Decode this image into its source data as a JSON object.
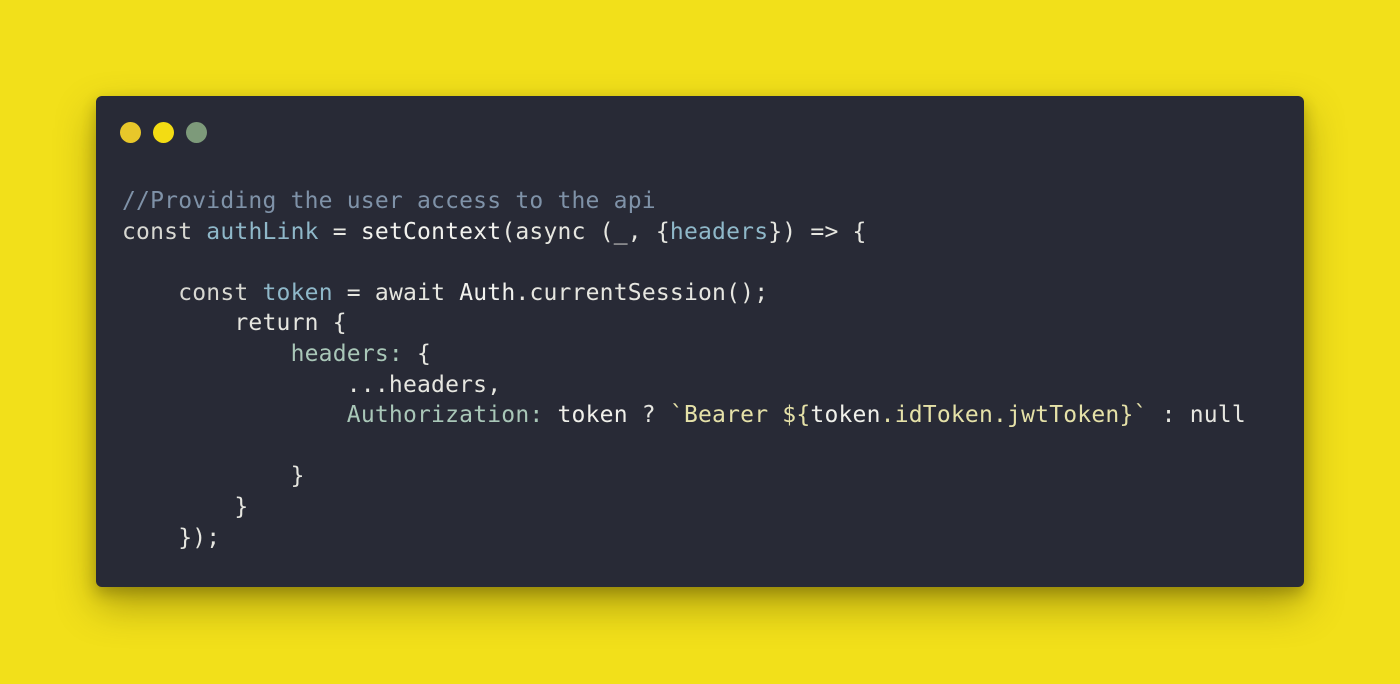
{
  "window": {
    "controls": [
      {
        "name": "close",
        "color": "#e8c72a"
      },
      {
        "name": "minimize",
        "color": "#f3dc13"
      },
      {
        "name": "maximize",
        "color": "#7d9a7a"
      }
    ]
  },
  "code": {
    "language": "javascript",
    "lines": [
      "//Providing the user access to the api",
      "const authLink = setContext(async (_, {headers}) => {",
      "",
      "    const token = await Auth.currentSession();",
      "        return {",
      "            headers: {",
      "                ...headers,",
      "                Authorization: token ? `Bearer ${token.idToken.jwtToken}` : null",
      "",
      "            }",
      "        }",
      "    });"
    ],
    "tokens": {
      "l0_comment": "//Providing the user access to the api",
      "l1_const": "const ",
      "l1_authLink": "authLink",
      "l1_eq": " = ",
      "l1_setContext": "setContext",
      "l1_async": "(async (_, {",
      "l1_headers": "headers",
      "l1_end": "}) => {",
      "l3_indent": "    ",
      "l3_const": "const ",
      "l3_token": "token",
      "l3_eq": " = await ",
      "l3_auth": "Auth",
      "l3_end": ".currentSession();",
      "l4": "        return {",
      "l5_indent": "            ",
      "l5_headers": "headers:",
      "l5_end": " {",
      "l6": "                ...headers,",
      "l7_indent": "                ",
      "l7_auth": "Authorization:",
      "l7_sp": " ",
      "l7_token": "token",
      "l7_q": " ? ",
      "l7_tpl1": "`Bearer ${",
      "l7_tok2": "token",
      "l7_tpl2": ".idToken.jwtToken",
      "l7_tpl3": "}`",
      "l7_end": " : null",
      "l9": "            }",
      "l10": "        }",
      "l11": "    });"
    }
  }
}
